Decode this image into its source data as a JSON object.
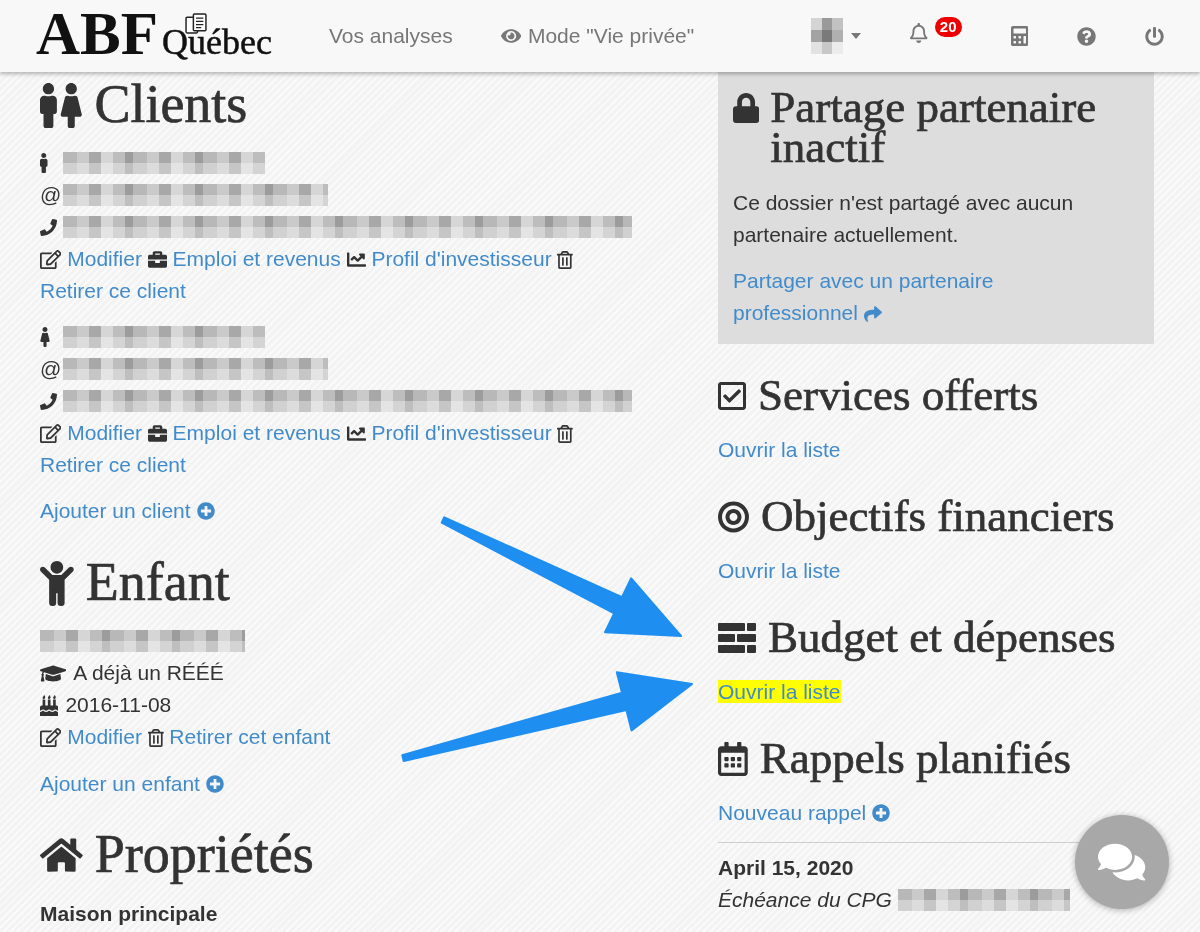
{
  "navbar": {
    "logo": {
      "main": "ABF",
      "sub": "Québec"
    },
    "links": [
      {
        "kind": "link",
        "label": "Vos analyses"
      },
      {
        "kind": "privacy",
        "label": "Mode \"Vie privée\""
      }
    ],
    "notifications": {
      "count": "20"
    }
  },
  "clients": {
    "title": "Clients",
    "items": [
      {
        "kind": "man",
        "contacts": [
          {
            "kind": "name"
          },
          {
            "kind": "email",
            "symbol": "@"
          },
          {
            "kind": "phone"
          }
        ],
        "actions": [
          {
            "kind": "edit",
            "label": "Modifier"
          },
          {
            "kind": "employment",
            "label": "Emploi et revenus"
          },
          {
            "kind": "profile",
            "label": "Profil d'investisseur"
          },
          {
            "kind": "remove",
            "label": "Retirer ce client"
          }
        ]
      },
      {
        "kind": "woman",
        "contacts": [
          {
            "kind": "name"
          },
          {
            "kind": "email",
            "symbol": "@"
          },
          {
            "kind": "phone"
          }
        ],
        "actions": [
          {
            "kind": "edit",
            "label": "Modifier"
          },
          {
            "kind": "employment",
            "label": "Emploi et revenus"
          },
          {
            "kind": "profile",
            "label": "Profil d'investisseur"
          },
          {
            "kind": "remove",
            "label": "Retirer ce client"
          }
        ]
      }
    ],
    "add_label": "Ajouter un client"
  },
  "kids": {
    "title": "Enfant",
    "items": [
      {
        "details": [
          {
            "kind": "name"
          },
          {
            "kind": "education",
            "text": "A déjà un RÉÉÉ"
          },
          {
            "kind": "birthday",
            "text": "2016-11-08"
          }
        ],
        "actions": [
          {
            "kind": "edit",
            "label": "Modifier"
          },
          {
            "kind": "remove",
            "label": "Retirer cet enfant"
          }
        ]
      }
    ],
    "add_label": "Ajouter un enfant"
  },
  "properties": {
    "title": "Propriétés",
    "items": [
      {
        "name": "Maison principale"
      }
    ]
  },
  "partner_sharing": {
    "title": "Partage partenaire inactif",
    "text": "Ce dossier n'est partagé avec aucun partenaire actuellement.",
    "link": "Partager avec un partenaire professionnel"
  },
  "sections": [
    {
      "kind": "services",
      "title": "Services offerts",
      "link": "Ouvrir la liste",
      "highlighted": false
    },
    {
      "kind": "objectives",
      "title": "Objectifs financiers",
      "link": "Ouvrir la liste",
      "highlighted": false
    },
    {
      "kind": "budget",
      "title": "Budget et dépenses",
      "link": "Ouvrir la liste",
      "highlighted": true
    }
  ],
  "reminders": {
    "title": "Rappels planifiés",
    "add_label": "Nouveau rappel",
    "items": [
      {
        "date": "April 15, 2020",
        "text": "Échéance du CPG",
        "redacted_tail": true
      }
    ]
  },
  "annotations": [
    {
      "kind": "arrow"
    },
    {
      "kind": "arrow"
    }
  ]
}
